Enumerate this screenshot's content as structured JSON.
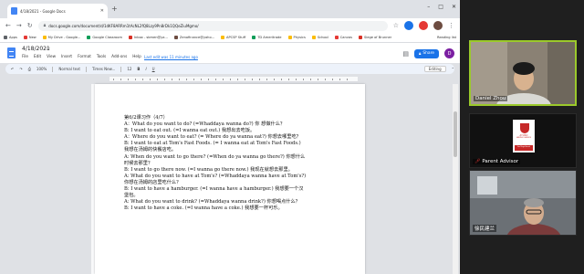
{
  "browser": {
    "tab_title": "4/18/2021 - Google Docs",
    "url": "docs.google.com/document/d/1dKF8ARRm1tAcNL2fQ8Lzy9Pn8rDk1QQeZiuMgmo/",
    "window_controls": [
      "–",
      "□",
      "✕"
    ],
    "bookmarks": [
      {
        "label": "Apps",
        "color": "#5f6368"
      },
      {
        "label": "New",
        "color": "#e53935"
      },
      {
        "label": "My Drive - Google...",
        "color": "#fbbc04"
      },
      {
        "label": "Google Classroom",
        "color": "#0f9d58"
      },
      {
        "label": "Inbox - sbmen@ya...",
        "color": "#d93025"
      },
      {
        "label": "Zenofinance@yaho...",
        "color": "#6d4c41"
      },
      {
        "label": "APCSP Stuff",
        "color": "#fbbc04"
      },
      {
        "label": "TD Ameritrade",
        "color": "#0f9d58"
      },
      {
        "label": "Physics",
        "color": "#fbbc04"
      },
      {
        "label": "School",
        "color": "#fbbc04"
      },
      {
        "label": "Canvas",
        "color": "#e53935"
      },
      {
        "label": "Siege of Brunner",
        "color": "#d93025"
      }
    ],
    "reading_list": "Reading list"
  },
  "docs": {
    "title": "4/18/2021",
    "menus": [
      "File",
      "Edit",
      "View",
      "Insert",
      "Format",
      "Tools",
      "Add-ons",
      "Help"
    ],
    "last_edit": "Last edit was 11 minutes ago",
    "share_label": "Share",
    "avatar_letter": "D",
    "toolbar": {
      "zoom": "100%",
      "style": "Normal text",
      "font": "Times New...",
      "size": "12",
      "mode": "Editing"
    },
    "body_lines": [
      "第6/2课习作（4/7）",
      "A：What do you want to do? (=Whaddaya wanna do?) 你 想做什么？",
      "B: I want to eat out. (=I wanna eat out.) 我想出去吃饭。",
      "A：Where do you want to eat? (= Where do ya wanna eat?) 你想去哪里吃？",
      "B: I want to eat at Tom's Fast Foods. (= I wanna eat at Tom's Fast Foods.) 我想在汤姆的快餐店吃。",
      "A: When do you want to go there? (=When do ya wanna go there?) 你想什么时候去那里？",
      "B: I want to go there now. (=I wanna go there now.) 我现在就想去那里。",
      "A: What do you want to have at Tom's? (=Whaddaya wanna have at Tom's?) 你想在汤姆的店里吃什么？",
      "B: I want to have a hamburger. (=I wanna have a hamburger.) 我想要一个汉堡包。",
      "A: What do you want to drink? (=Whaddaya wanna drink?) 你想喝点什么？",
      "B: I want to have a coke. (=I wanna have a coke.) 我想要一杯可乐。"
    ]
  },
  "participants": [
    {
      "name": "Daniel Zhou"
    },
    {
      "name": "Parent Advisor",
      "logo_text": "AYUSO",
      "logo_sub": "MAKING LEADERS",
      "logo_band": "San Diego Branch"
    },
    {
      "name": "徐民建兰"
    }
  ]
}
